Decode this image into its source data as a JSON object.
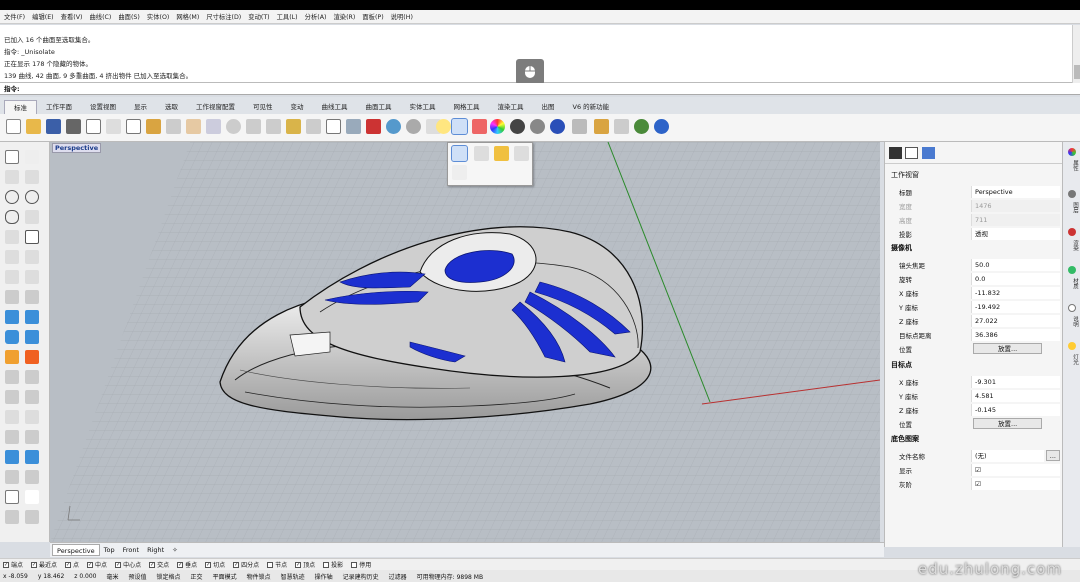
{
  "menu": [
    "文件(F)",
    "编辑(E)",
    "查看(V)",
    "曲线(C)",
    "曲面(S)",
    "实体(O)",
    "网格(M)",
    "尺寸标注(D)",
    "变动(T)",
    "工具(L)",
    "分析(A)",
    "渲染(R)",
    "面板(P)",
    "说明(H)"
  ],
  "history": [
    "已加入 16 个曲面至选取集合。",
    "指令: _Unisolate",
    "正在显示 178 个隐藏的物体。",
    "139 曲线, 42 曲面, 9 多重曲面, 4 挤出物件 已加入至选取集合。"
  ],
  "prompt": "指令:",
  "tabs": [
    "标准",
    "工作平面",
    "设置视图",
    "显示",
    "选取",
    "工作视窗配置",
    "可见性",
    "变动",
    "曲线工具",
    "曲面工具",
    "实体工具",
    "网格工具",
    "渲染工具",
    "出图",
    "V6 的新功能"
  ],
  "viewport": {
    "label": "Perspective"
  },
  "panel": {
    "title": "工作视窗",
    "rows": [
      {
        "k": "标题",
        "v": "Perspective",
        "gray": false
      },
      {
        "k": "宽度",
        "v": "1476",
        "gray": true
      },
      {
        "k": "高度",
        "v": "711",
        "gray": true
      },
      {
        "k": "投影",
        "v": "透视",
        "gray": false
      }
    ],
    "camera_title": "摄像机",
    "camera": [
      {
        "k": "镜头焦距",
        "v": "50.0"
      },
      {
        "k": "旋转",
        "v": "0.0"
      },
      {
        "k": "X 座标",
        "v": "-11.832"
      },
      {
        "k": "Y 座标",
        "v": "-19.492"
      },
      {
        "k": "Z 座标",
        "v": "27.022"
      },
      {
        "k": "目标点距离",
        "v": "36.386"
      }
    ],
    "position_label": "位置",
    "place_button": "放置...",
    "target_title": "目标点",
    "target": [
      {
        "k": "X 座标",
        "v": "-9.301"
      },
      {
        "k": "Y 座标",
        "v": "4.581"
      },
      {
        "k": "Z 座标",
        "v": "-0.145"
      }
    ],
    "bg_title": "底色图案",
    "bg": [
      {
        "k": "文件名称",
        "v": "(无)"
      },
      {
        "k": "显示",
        "v": "☑"
      },
      {
        "k": "灰阶",
        "v": "☑"
      }
    ],
    "browse_button": "..."
  },
  "sidetabs": [
    "属性",
    "图层",
    "渲染",
    "材质",
    "说明",
    "灯光"
  ],
  "view_tabs": [
    "Perspective",
    "Top",
    "Front",
    "Right",
    "✧"
  ],
  "osnaps": [
    "端点",
    "最近点",
    "点",
    "中点",
    "中心点",
    "交点",
    "垂点",
    "切点",
    "四分点",
    "节点",
    "顶点",
    "投影",
    "停用"
  ],
  "status": [
    "x -8.059",
    "y 18.462",
    "z 0.000",
    "毫米",
    "预设值",
    "锁定格点",
    "正交",
    "平面模式",
    "物件锁点",
    "智慧轨迹",
    "操作轴",
    "记录建构历史",
    "过滤器",
    "可用物理内存: 9898 MB"
  ],
  "watermark": "edu.zhulong.com",
  "colors": {
    "accent_blue": "#1c2fd0",
    "grid_green": "#2a8a2a",
    "axis_red": "#b83030"
  }
}
